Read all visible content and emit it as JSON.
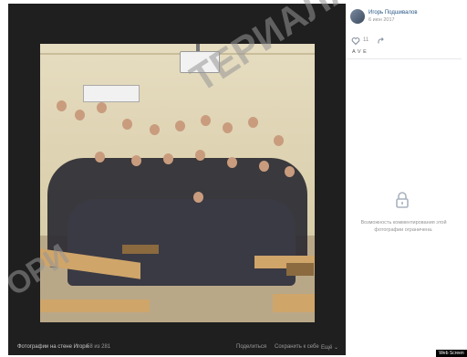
{
  "photo": {
    "alt": "group photo"
  },
  "footer": {
    "album_label": "Фотографии на стене Игоря",
    "counter": "58 из 281",
    "share": "Поделиться",
    "save": "Сохранить к себе",
    "more": "Ещё ⌄"
  },
  "panel": {
    "author": "Игорь Подшивалов",
    "date": "6 июн 2017",
    "likes": "11",
    "likers": "A V E",
    "comments_disabled": "Возможность комментирования этой фотографии ограничена."
  },
  "badge": "Web Screen",
  "watermark": {
    "line1": "ТЕРИАЛА НА",
    "line2": "ОРИ"
  },
  "colors": {
    "viewer_bg": "#1f1f1f",
    "link": "#2a5885",
    "muted": "#939393"
  },
  "icons": [
    "heart-icon",
    "share-icon",
    "lock-icon"
  ]
}
